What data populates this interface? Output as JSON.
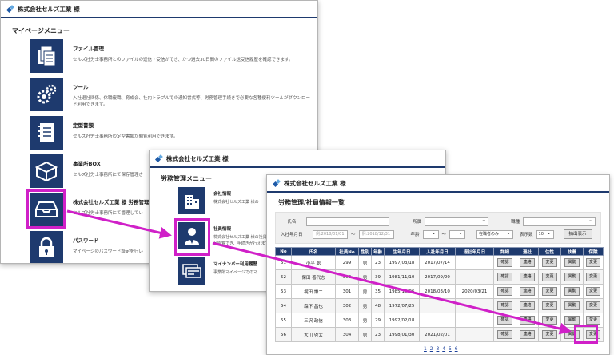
{
  "colors": {
    "accent": "#1e3a6e",
    "highlight": "#d020c8"
  },
  "window1": {
    "company": "株式会社セルズ工業 様",
    "menu_title": "マイページメニュー",
    "items": [
      {
        "icon": "file-folder-icon",
        "title": "ファイル管理",
        "desc": "セルズ社労士事務所とのファイルの送信・受信ができ、かつ過去30日間のファイル送受信履歴を確認できます。"
      },
      {
        "icon": "gear-tools-icon",
        "title": "ツール",
        "desc": "入社退社関係、休職復職、育成会、社内トラブルでの通知書式等、労務管理手続きで必要な各種便利ツールがダウンロード利用できます。"
      },
      {
        "icon": "notebook-icon",
        "title": "定型書類",
        "desc": "セルズ社労士事務所の定型書類が閲覧利用できます。"
      },
      {
        "icon": "box-icon",
        "title": "事業所BOX",
        "desc": "セルズ社労士事務所にて保存管理さ"
      },
      {
        "icon": "inbox-tray-icon",
        "title": "株式会社セルズ工業 様 労務管理",
        "desc": "セルズ社労士事務所にて管理してい"
      },
      {
        "icon": "lock-icon",
        "title": "パスワード",
        "desc": "マイページのパスワード設定を行い"
      }
    ]
  },
  "window2": {
    "company": "株式会社セルズ工業 様",
    "menu_title": "労務管理メニュー",
    "items": [
      {
        "icon": "building-icon",
        "title": "会社情報",
        "desc": "株式会社セルズ工業 様の"
      },
      {
        "icon": "person-icon",
        "title": "社員情報",
        "desc": "株式会社セルズ工業 様の社員情報が閲覧でき、手続きが行えます。"
      },
      {
        "icon": "cards-icon",
        "title": "マイナンバー利用履歴",
        "desc": "事業所マイページでのマ"
      }
    ]
  },
  "window3": {
    "company": "株式会社セルズ工業 様",
    "section_title": "労務管理/社員情報一覧",
    "filters": {
      "name_label": "氏名",
      "dept_label": "所属",
      "position_label": "職種",
      "hire_label": "入社年月日",
      "hire_from_placeholder": "例:2018/01/01",
      "range_sep": "〜",
      "hire_to_placeholder": "例:2018/12/31",
      "age_label": "年齢",
      "status_value": "在職者のみ",
      "count_label": "表示数",
      "count_value": "10",
      "extract_label": "抽出表示"
    },
    "columns": [
      "No",
      "氏名",
      "社員No",
      "性別",
      "年齢",
      "生年月日",
      "入社年月日",
      "退社年月日",
      "詳細",
      "過社",
      "住性",
      "扶養",
      "保険"
    ],
    "buttons": {
      "detail": "確認",
      "contact": "連絡",
      "change": "変更",
      "transfer": "異動"
    },
    "rows": [
      {
        "no": "51",
        "name": "小平 聡",
        "emp": "299",
        "sex": "男",
        "age": "23",
        "birth": "1997/03/18",
        "hire": "2017/07/14",
        "leave": ""
      },
      {
        "no": "52",
        "name": "保田 善代志",
        "emp": "300",
        "sex": "男",
        "age": "39",
        "birth": "1981/11/10",
        "hire": "2017/09/20",
        "leave": ""
      },
      {
        "no": "53",
        "name": "梶田 謙二",
        "emp": "301",
        "sex": "男",
        "age": "35",
        "birth": "1985/10/06",
        "hire": "2018/03/10",
        "leave": "2020/03/21"
      },
      {
        "no": "54",
        "name": "森下 昌也",
        "emp": "302",
        "sex": "男",
        "age": "48",
        "birth": "1972/07/25",
        "hire": "",
        "leave": ""
      },
      {
        "no": "55",
        "name": "三沢 政信",
        "emp": "303",
        "sex": "男",
        "age": "29",
        "birth": "1992/02/18",
        "hire": "",
        "leave": ""
      },
      {
        "no": "56",
        "name": "大川 啓太",
        "emp": "304",
        "sex": "男",
        "age": "23",
        "birth": "1998/01/30",
        "hire": "2021/02/01",
        "leave": ""
      }
    ],
    "pager": [
      "1",
      "2",
      "3",
      "4",
      "5",
      "6"
    ]
  }
}
